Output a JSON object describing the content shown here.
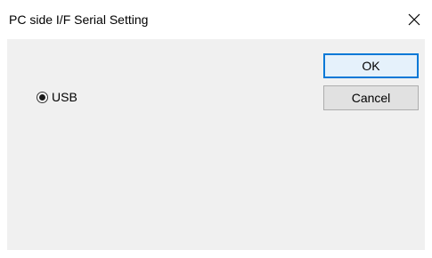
{
  "window": {
    "title": "PC side I/F Serial Setting"
  },
  "options": {
    "usb_label": "USB",
    "usb_selected": true
  },
  "buttons": {
    "ok_label": "OK",
    "cancel_label": "Cancel"
  },
  "icons": {
    "close": "close-icon",
    "radio": "radio-selected-icon"
  },
  "colors": {
    "accent": "#0078d7",
    "client_background": "#f0f0f0",
    "button_face": "#e1e1e1"
  }
}
